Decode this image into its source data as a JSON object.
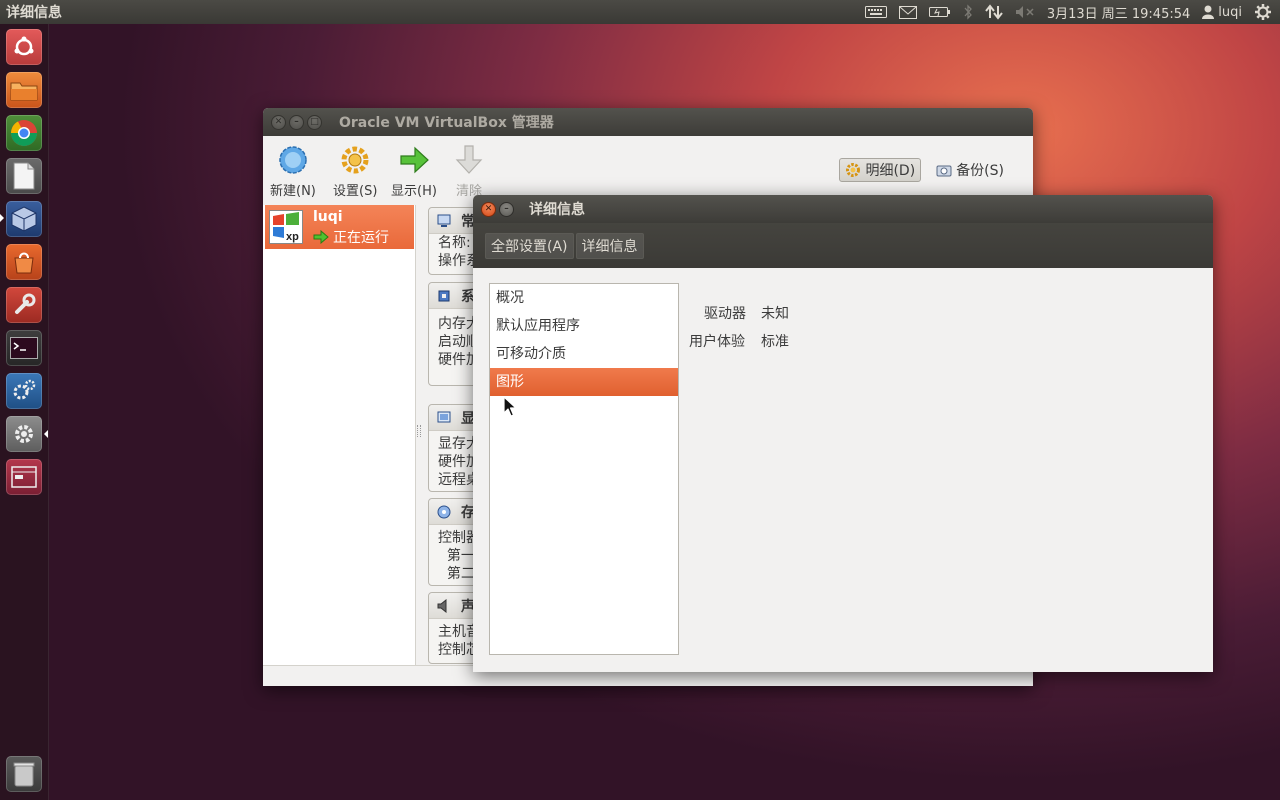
{
  "top_panel": {
    "app_title": "详细信息",
    "clock": "3月13日 周三 19:45:54",
    "user": "luqi"
  },
  "vbox_window": {
    "title": "Oracle VM VirtualBox 管理器",
    "toolbar": {
      "new_label": "新建(N)",
      "settings_label": "设置(S)",
      "show_label": "显示(H)",
      "discard_label": "清除"
    },
    "modes": {
      "details_label": "明细(D)",
      "snapshots_label": "备份(S)"
    },
    "vm": {
      "name": "luqi",
      "state": "正在运行",
      "os_badge": "xp"
    },
    "sections": [
      {
        "header": "常",
        "rows": [
          "名称:",
          "操作系"
        ]
      },
      {
        "header": "系",
        "rows": [
          "内存大",
          "启动顺",
          "硬件加"
        ]
      },
      {
        "header": "显",
        "rows": [
          "显存大",
          "硬件加",
          "远程桌"
        ]
      },
      {
        "header": "存",
        "rows": [
          "控制器",
          "  第一",
          "  第二"
        ]
      },
      {
        "header": "声",
        "rows": [
          "主机音",
          "控制芯"
        ]
      }
    ]
  },
  "details_dialog": {
    "title": "详细信息",
    "tabs": [
      {
        "label": "全部设置(A)"
      },
      {
        "label": "详细信息"
      }
    ],
    "categories": [
      {
        "label": "概况"
      },
      {
        "label": "默认应用程序"
      },
      {
        "label": "可移动介质"
      },
      {
        "label": "图形"
      }
    ],
    "properties": [
      {
        "key": "驱动器",
        "value": "未知"
      },
      {
        "key": "用户体验",
        "value": "标准"
      }
    ]
  },
  "colors": {
    "accent_orange": "#e9693a",
    "panel_dark": "#3c3b37",
    "window_bg": "#f2f1f0"
  }
}
